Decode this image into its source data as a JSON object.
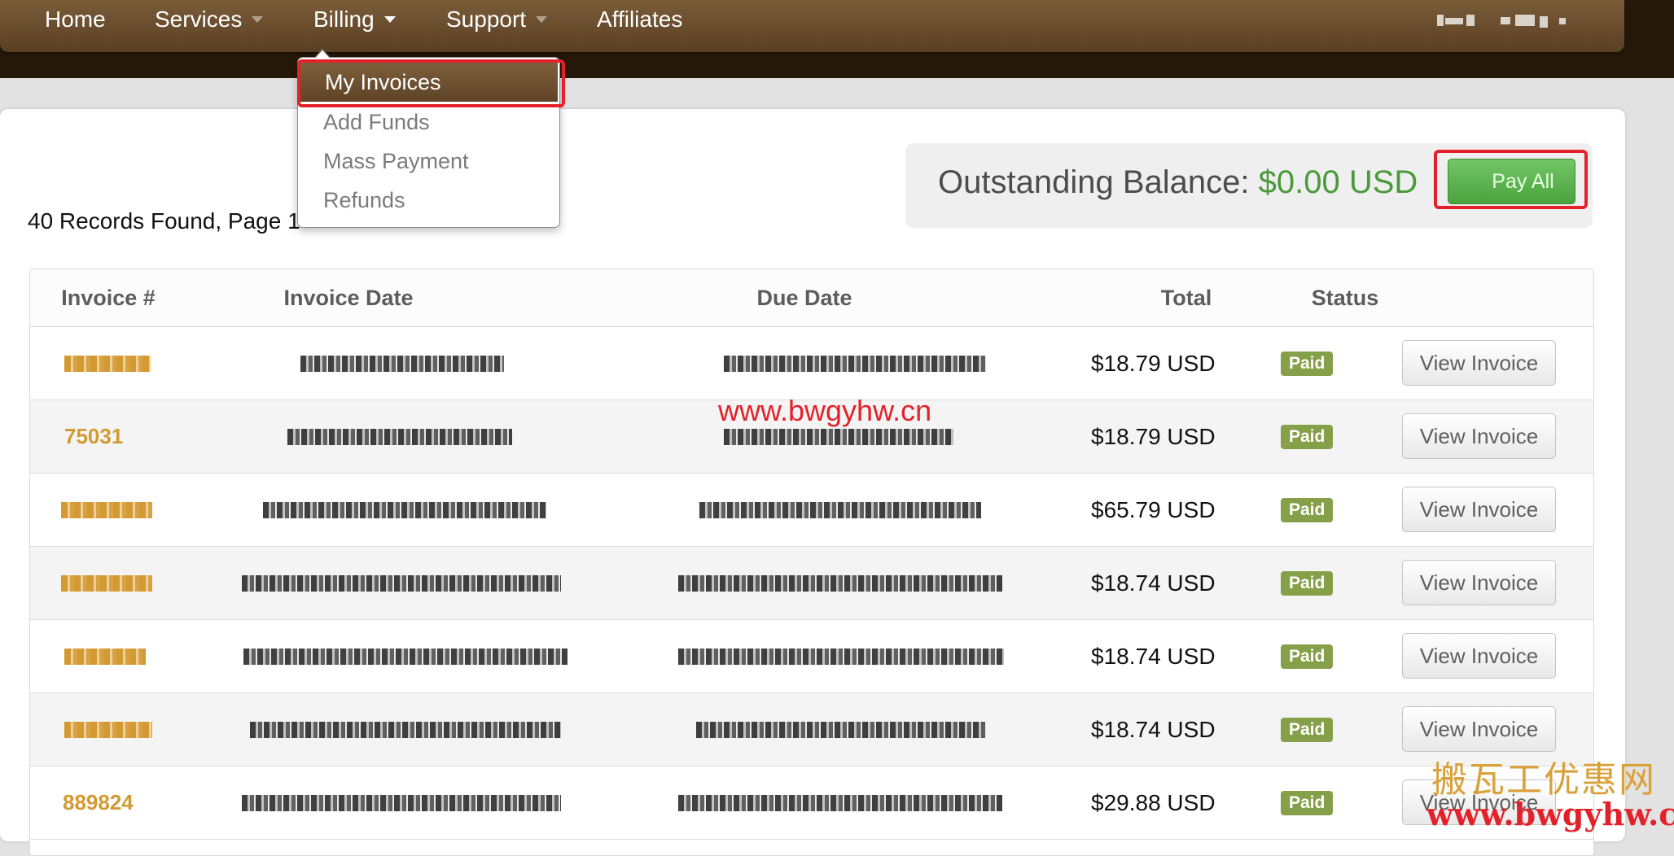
{
  "nav": {
    "home": "Home",
    "services": "Services",
    "billing": "Billing",
    "support": "Support",
    "affiliates": "Affiliates"
  },
  "billing_menu": {
    "items": [
      "My Invoices",
      "Add Funds",
      "Mass Payment",
      "Refunds"
    ],
    "selected": "My Invoices"
  },
  "records_text": "40 Records Found, Page 1",
  "balance": {
    "label": "Outstanding Balance:",
    "amount": "$0.00 USD",
    "pay_all": "Pay All"
  },
  "table": {
    "headers": [
      "Invoice #",
      "Invoice Date",
      "Due Date",
      "Total",
      "Status"
    ],
    "rows": [
      {
        "invoice": "",
        "total": "$18.79 USD",
        "status": "Paid",
        "action": "View Invoice"
      },
      {
        "invoice": "75031",
        "total": "$18.79 USD",
        "status": "Paid",
        "action": "View Invoice"
      },
      {
        "invoice": "",
        "total": "$65.79 USD",
        "status": "Paid",
        "action": "View Invoice"
      },
      {
        "invoice": "",
        "total": "$18.74 USD",
        "status": "Paid",
        "action": "View Invoice"
      },
      {
        "invoice": "",
        "total": "$18.74 USD",
        "status": "Paid",
        "action": "View Invoice"
      },
      {
        "invoice": "",
        "total": "$18.74 USD",
        "status": "Paid",
        "action": "View Invoice"
      },
      {
        "invoice": "889824",
        "total": "$29.88 USD",
        "status": "Paid",
        "action": "View Invoice"
      }
    ]
  },
  "watermarks": {
    "center": "www.bwgyhw.cn",
    "corner_cn": "搬瓦工优惠网",
    "corner_url": "www.bwgyhw.cn"
  },
  "colors": {
    "nav_brown": "#6b4d2e",
    "balance_green": "#4a9a3b",
    "paid_green": "#86a04a",
    "invoice_orange": "#d39a34",
    "highlight_red": "#e3212a"
  }
}
